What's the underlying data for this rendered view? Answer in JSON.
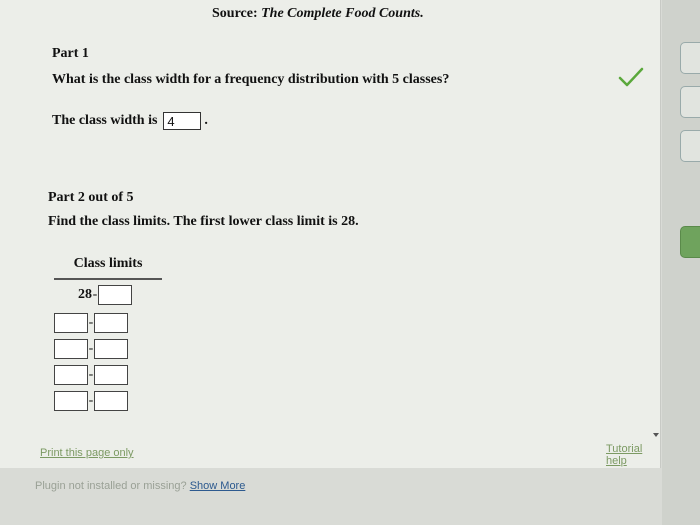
{
  "source": {
    "label": "Source:",
    "title": "The Complete Food Counts."
  },
  "part1": {
    "title": "Part 1",
    "question": "What is the class width for a frequency distribution with 5 classes?",
    "answer_label": "The class width is",
    "answer_value": "4",
    "answer_suffix": "."
  },
  "part2": {
    "title": "Part 2 out of 5",
    "question": "Find the class limits. The first lower class limit is 28."
  },
  "table": {
    "header": "Class limits",
    "first_lower": "28",
    "dash": "-"
  },
  "links": {
    "print": "Print this page only",
    "tutorial": "Tutorial help"
  },
  "plugin": {
    "message": "Plugin not installed or missing?",
    "show_more": "Show More"
  },
  "colors": {
    "check": "#5aa83b",
    "link": "#2d5a8f"
  }
}
